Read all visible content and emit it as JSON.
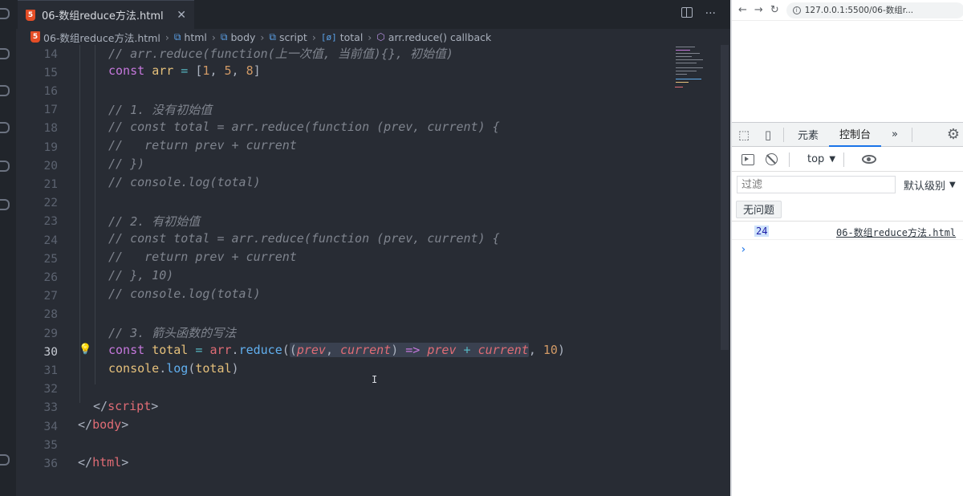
{
  "editor": {
    "tab": {
      "title": "06-数组reduce方法.html",
      "close": "✕"
    },
    "breadcrumb": {
      "file": "06-数组reduce方法.html",
      "html": "html",
      "body": "body",
      "script": "script",
      "total": "total",
      "callback": "arr.reduce() callback"
    },
    "line_numbers": [
      "14",
      "15",
      "16",
      "17",
      "18",
      "19",
      "20",
      "21",
      "22",
      "23",
      "24",
      "25",
      "26",
      "27",
      "28",
      "29",
      "30",
      "31",
      "32",
      "33",
      "34",
      "35",
      "36"
    ],
    "active_line": "30",
    "code": {
      "l14": "// arr.reduce(function(上一次值, 当前值){}, 初始值)",
      "l15_kw": "const",
      "l15_var": "arr",
      "l15_eq": " = ",
      "l15_open": "[",
      "l15_n1": "1",
      "l15_c1": ", ",
      "l15_n2": "5",
      "l15_c2": ", ",
      "l15_n3": "8",
      "l15_close": "]",
      "l17": "// 1. 没有初始值",
      "l18": "// const total = arr.reduce(function (prev, current) {",
      "l19": "//   return prev + current",
      "l20": "// })",
      "l21": "// console.log(total)",
      "l23": "// 2. 有初始值",
      "l24": "// const total = arr.reduce(function (prev, current) {",
      "l25": "//   return prev + current",
      "l26": "// }, 10)",
      "l27": "// console.log(total)",
      "l29": "// 3. 箭头函数的写法",
      "l30_kw": "const",
      "l30_var": "total",
      "l30_eq": " = ",
      "l30_obj": "arr",
      "l30_dot": ".",
      "l30_fn": "reduce",
      "l30_p1": "(",
      "l30_p2": "(",
      "l30_prev": "prev",
      "l30_comma": ", ",
      "l30_cur": "current",
      "l30_p3": ")",
      "l30_arrow": " => ",
      "l30_prev2": "prev",
      "l30_plus": " + ",
      "l30_cur2": "current",
      "l30_comma2": ", ",
      "l30_num": "10",
      "l30_p4": ")",
      "l31_obj": "console",
      "l31_dot": ".",
      "l31_fn": "log",
      "l31_p1": "(",
      "l31_arg": "total",
      "l31_p2": ")",
      "l33_open": "</",
      "l33_tag": "script",
      "l33_close": ">",
      "l34_open": "</",
      "l34_tag": "body",
      "l34_close": ">",
      "l36_open": "</",
      "l36_tag": "html",
      "l36_close": ">"
    }
  },
  "browser": {
    "url": "127.0.0.1:5500/06-数组r..."
  },
  "devtools": {
    "tabs": [
      "元素",
      "控制台"
    ],
    "more": "»",
    "context": "top",
    "filter_placeholder": "过滤",
    "level": "默认级别",
    "issues": "无问题",
    "log": {
      "value": "24",
      "source": "06-数组reduce方法.html"
    },
    "prompt": "›"
  },
  "colors": {
    "editor_bg": "#282c34",
    "comment": "#7f848e",
    "keyword": "#c678dd",
    "variable": "#e5c07b",
    "function": "#61afef",
    "number": "#d19a66",
    "tag": "#e06c75",
    "devtools_accent": "#1a73e8"
  }
}
